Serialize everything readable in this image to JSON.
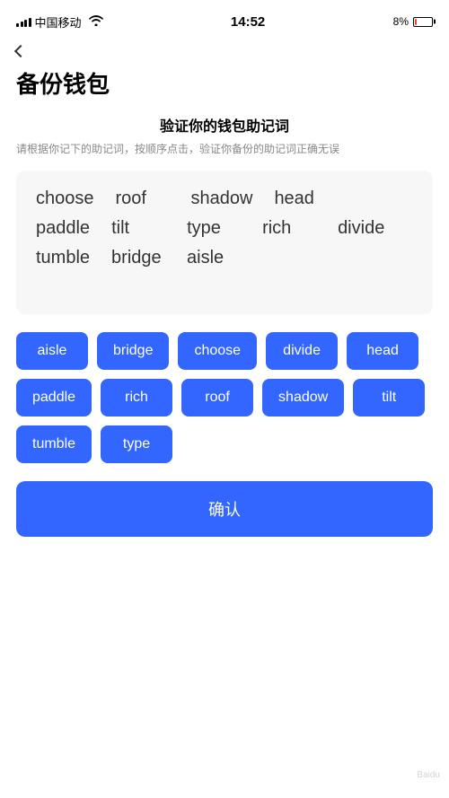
{
  "statusBar": {
    "carrier": "中国移动",
    "time": "14:52",
    "battery_pct": "8%",
    "wifi": true
  },
  "back_label": "‹",
  "pageTitle": "备份钱包",
  "sectionHeading": "验证你的钱包助记词",
  "sectionDesc": "请根据你记下的助记词，按顺序点击，验证你备份的助记词正确无误",
  "wordGrid": {
    "rows": [
      [
        "choose",
        "roof",
        "shadow",
        "head"
      ],
      [
        "paddle",
        "tilt",
        "type",
        "rich",
        "divide"
      ],
      [
        "tumble",
        "bridge",
        "aisle"
      ]
    ]
  },
  "keywords": [
    "aisle",
    "bridge",
    "choose",
    "divide",
    "head",
    "paddle",
    "rich",
    "roof",
    "shadow",
    "tilt",
    "tumble",
    "type"
  ],
  "confirmBtn": "确认"
}
